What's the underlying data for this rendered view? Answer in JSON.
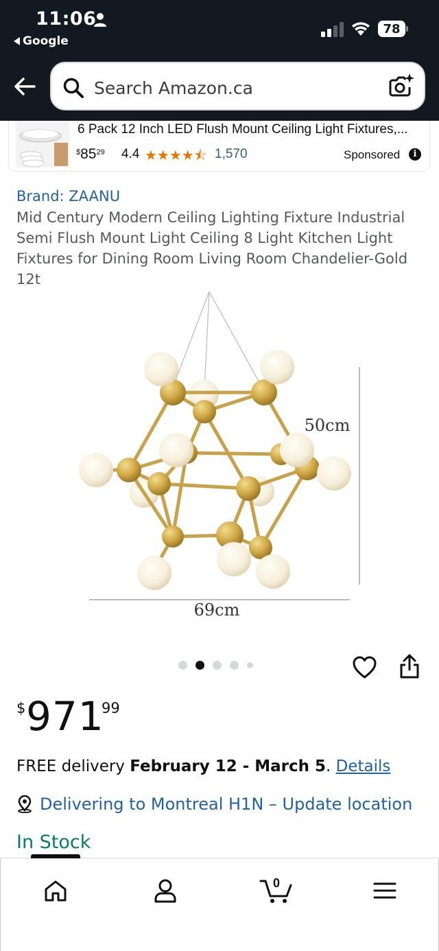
{
  "status_bar": {
    "time": "11:06",
    "back_app": "Google",
    "battery": "78"
  },
  "search": {
    "placeholder": "Search Amazon.ca"
  },
  "ad": {
    "title": "6 Pack 12 Inch LED Flush Mount Ceiling Light Fixtures,...",
    "price_symbol": "$",
    "price_whole": "85",
    "price_fraction": "29",
    "rating": "4.4",
    "stars": "★★★★⯪",
    "review_count": "1,570",
    "sponsored_label": "Sponsored",
    "info_glyph": "i"
  },
  "product": {
    "brand": "Brand: ZAANU",
    "title": "Mid Century Modern Ceiling Lighting Fixture Industrial Semi Flush Mount Light Ceiling 8 Light Kitchen Light Fixtures for Dining Room Living Room Chandelier-Gold 12t",
    "image": {
      "height_label": "50cm",
      "width_label": "69cm"
    },
    "image_count": 5,
    "active_image": 2,
    "price": {
      "symbol": "$",
      "whole": "971",
      "fraction": "99"
    },
    "delivery": {
      "prefix": "FREE delivery ",
      "dates": "February 12 - March 5",
      "suffix": ". ",
      "link": "Details"
    },
    "location": "Delivering to Montreal H1N – Update location",
    "stock": "In Stock"
  },
  "bottom_nav": {
    "items": [
      "home-icon",
      "account-icon",
      "cart-icon",
      "menu-icon"
    ],
    "cart_count": "0",
    "active": "home"
  },
  "colors": {
    "header_bg": "#131921",
    "link": "#2162a1",
    "in_stock": "#067d62",
    "stars": "#e77600"
  }
}
